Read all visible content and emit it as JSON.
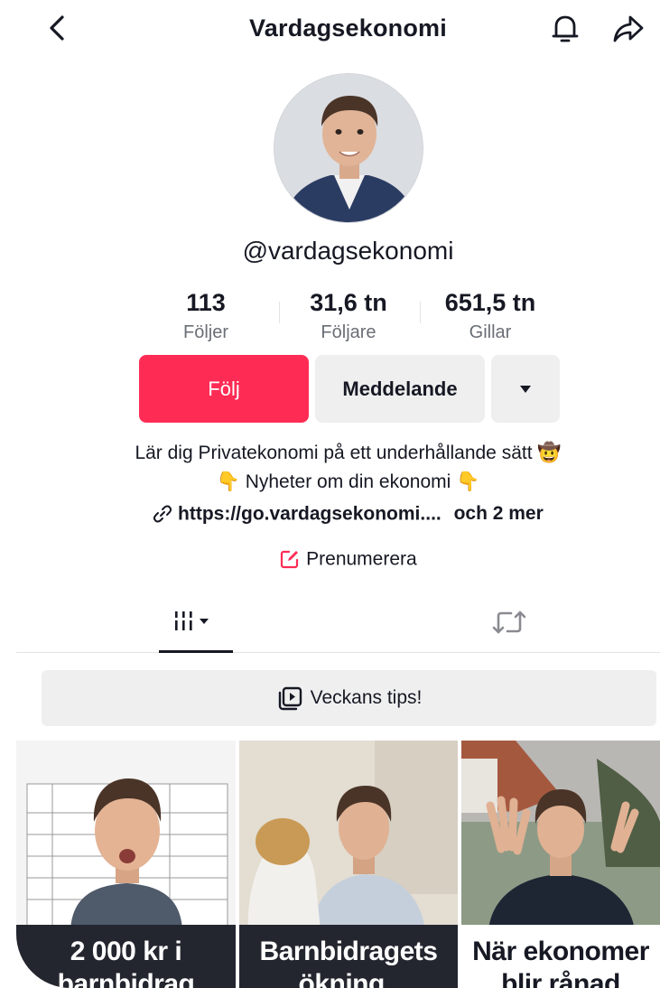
{
  "header": {
    "title": "Vardagsekonomi",
    "back_icon": "chevron-left-icon",
    "bell_icon": "bell-icon",
    "share_icon": "share-arrow-icon"
  },
  "profile": {
    "username": "@vardagsekonomi",
    "stats": [
      {
        "value": "113",
        "label": "Följer"
      },
      {
        "value": "31,6 tn",
        "label": "Följare"
      },
      {
        "value": "651,5 tn",
        "label": "Gillar"
      }
    ],
    "buttons": {
      "follow": "Följ",
      "message": "Meddelande",
      "more_icon": "caret-down-icon"
    },
    "bio_line1": "Lär dig Privatekonomi på ett underhållande sätt",
    "bio_line1_emoji": "🤠",
    "bio_line2_emoji_left": "👇",
    "bio_line2": "Nyheter om din ekonomi",
    "bio_line2_emoji_right": "👇",
    "link": "https://go.vardagsekonomi....",
    "link_more": "och 2 mer",
    "subscribe": "Prenumerera"
  },
  "tabs": {
    "videos_icon": "grid-bars-icon",
    "reposts_icon": "repost-icon"
  },
  "playlist": {
    "label": "Veckans tips!",
    "icon": "playlist-icon"
  },
  "videos": [
    {
      "caption_line1": "2 000 kr i",
      "caption_line2": "barnbidrag"
    },
    {
      "caption_line1": "Barnbidragets",
      "caption_line2": "ökning.."
    },
    {
      "caption_line1": "När ekonomer",
      "caption_line2": "blir rånad"
    }
  ],
  "colors": {
    "accent": "#fe2c55",
    "text": "#161823",
    "secondary_text": "#6b6e76",
    "button_gray": "#efeff0"
  }
}
